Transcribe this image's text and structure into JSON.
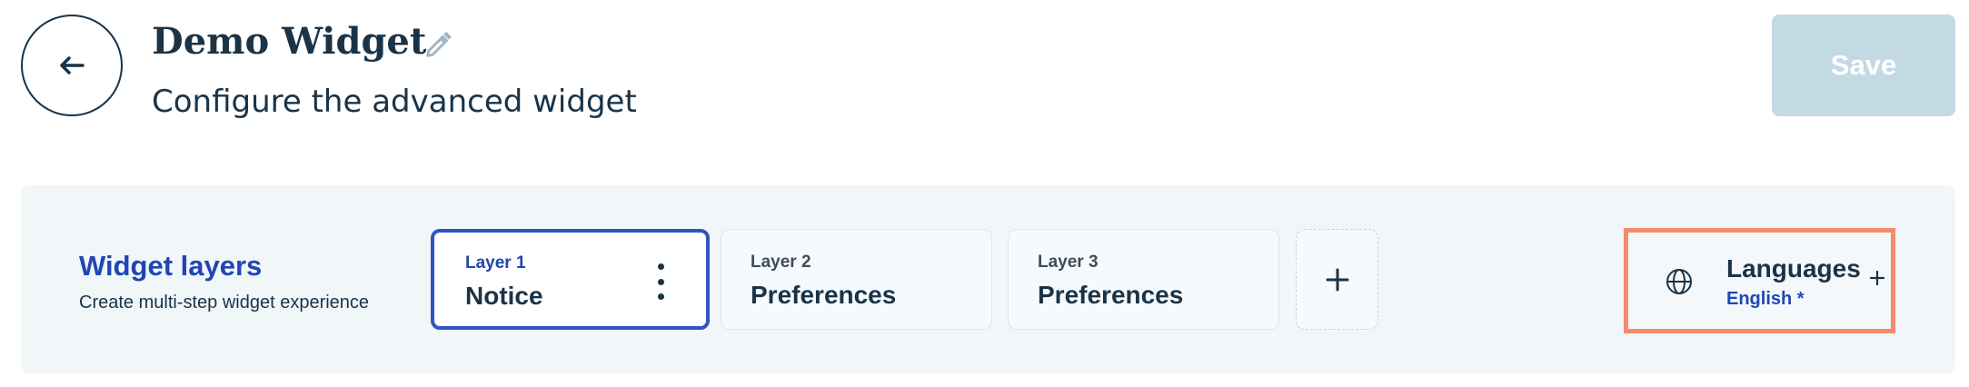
{
  "header": {
    "back_icon": "arrow-left-icon",
    "title": "Demo Widget",
    "edit_icon": "pencil-icon",
    "subtitle": "Configure the advanced widget",
    "save_label": "Save"
  },
  "layers_panel": {
    "title": "Widget layers",
    "description": "Create multi-step widget experience",
    "layers": [
      {
        "number": "Layer 1",
        "name": "Notice",
        "active": true
      },
      {
        "number": "Layer 2",
        "name": "Preferences",
        "active": false
      },
      {
        "number": "Layer 3",
        "name": "Preferences",
        "active": false
      }
    ],
    "add_icon": "plus-icon"
  },
  "languages": {
    "icon": "globe-icon",
    "label": "Languages",
    "value": "English *",
    "add_icon": "plus-icon"
  },
  "colors": {
    "primary_text": "#1a3347",
    "accent_blue": "#2146b3",
    "save_disabled": "#c3dae3",
    "highlight_orange": "#f58b6a",
    "panel_bg": "#f1f6f9"
  }
}
